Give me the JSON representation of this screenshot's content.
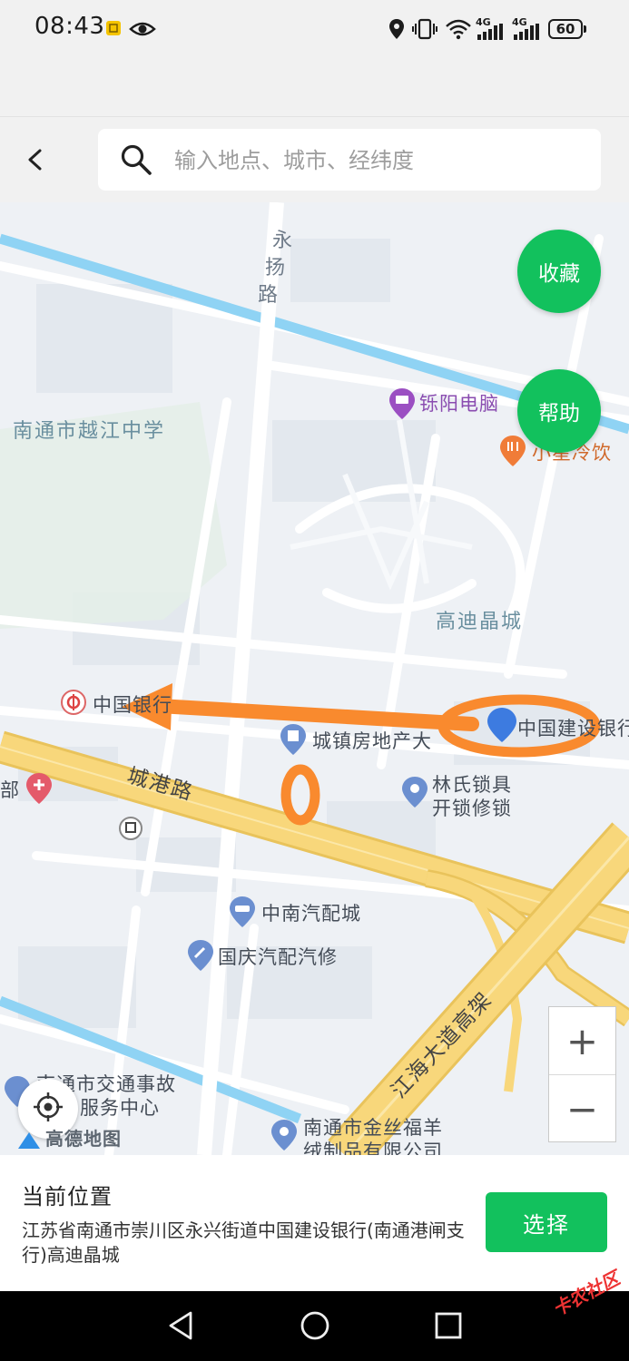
{
  "status_bar": {
    "time": "08:43",
    "signal_1": "4G",
    "signal_2": "4G",
    "battery": "60",
    "icons": [
      "notification-icon",
      "eye-icon",
      "location-icon",
      "vibrate-icon",
      "wifi-icon",
      "signal-icon",
      "battery-icon"
    ]
  },
  "search": {
    "placeholder": "输入地点、城市、经纬度"
  },
  "map": {
    "road_labels": {
      "yongyang": [
        "永",
        "扬",
        "路"
      ],
      "chenggang": "城港路",
      "jianghai": "江海大道高架"
    },
    "area_labels": {
      "school": "南通市越江中学",
      "gaodi": "高迪晶城"
    },
    "pois": {
      "shuoyang": "铄阳电脑",
      "xiaoxing": "小星冷饮",
      "boc": "中国银行",
      "realty": "城镇房地产大",
      "ccb": "中国建设银行",
      "lock_1": "林氏锁具",
      "lock_2": "开锁修锁",
      "auto_parts": "中南汽配城",
      "auto_repair": "国庆汽配汽修",
      "traffic_1": "南通市交通事故",
      "traffic_2": "服务中心",
      "wool_1": "南通市金丝福羊",
      "wool_2": "绒制品有限公司",
      "hospital_partial": "部"
    },
    "buttons": {
      "favorite": "收藏",
      "help": "帮助",
      "zoom_in": "+",
      "zoom_out": "−"
    },
    "logo": "高德地图",
    "colors": {
      "water": "#8fd3f4",
      "major_road": "#f8d77b",
      "road_edge": "#e9c35b",
      "annotation": "#f98a2e",
      "accent": "#12c15d"
    }
  },
  "panel": {
    "title": "当前位置",
    "address": "江苏省南通市崇川区永兴街道中国建设银行(南通港闸支行)高迪晶城",
    "select_label": "选择"
  },
  "watermark": "卡农社区"
}
